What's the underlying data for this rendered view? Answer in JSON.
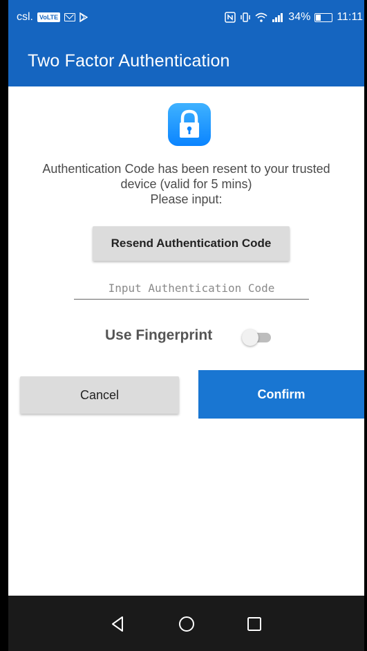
{
  "status_bar": {
    "carrier": "csl.",
    "volte_badge": "VoLTE",
    "battery_percent": "34%",
    "battery_level": 0.34,
    "time": "11:11",
    "icons": [
      "volte-icon",
      "mail-icon",
      "play-store-icon",
      "nfc-icon",
      "vibrate-icon",
      "wifi-icon",
      "signal-icon",
      "battery-icon"
    ]
  },
  "app_bar": {
    "title": "Two Factor Authentication",
    "color": "#1565c0"
  },
  "content": {
    "lock_icon": "lock-icon",
    "message_line1": "Authentication Code has been resent to your trusted",
    "message_line2": "device (valid for 5 mins)",
    "message_line3": "Please input:",
    "resend_label": "Resend Authentication Code",
    "input": {
      "value": "",
      "placeholder": "Input Authentication Code"
    },
    "fingerprint_label": "Use Fingerprint",
    "fingerprint_enabled": false
  },
  "actions": {
    "cancel_label": "Cancel",
    "confirm_label": "Confirm",
    "confirm_color": "#1976d2"
  },
  "nav_bar": {
    "icons": [
      "back-icon",
      "home-icon",
      "recents-icon"
    ]
  }
}
